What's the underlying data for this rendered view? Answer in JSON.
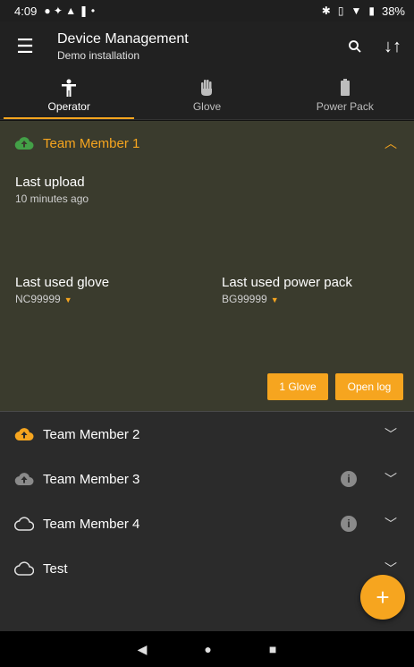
{
  "status_bar": {
    "time": "4:09",
    "battery": "38%"
  },
  "app_bar": {
    "title": "Device Management",
    "subtitle": "Demo installation"
  },
  "tabs": [
    {
      "label": "Operator",
      "icon": "person-icon",
      "active": true
    },
    {
      "label": "Glove",
      "icon": "hand-icon",
      "active": false
    },
    {
      "label": "Power Pack",
      "icon": "battery-icon",
      "active": false
    }
  ],
  "expanded_member": {
    "name": "Team Member 1",
    "cloud": "cloud-upload-green",
    "last_upload_label": "Last upload",
    "last_upload_value": "10 minutes ago",
    "last_glove_label": "Last used glove",
    "last_glove_value": "NC99999",
    "last_pack_label": "Last used power pack",
    "last_pack_value": "BG99999",
    "glove_button": "1 Glove",
    "open_log_button": "Open log"
  },
  "members": [
    {
      "name": "Team Member 2",
      "cloud": "cloud-upload-orange",
      "info": false
    },
    {
      "name": "Team Member 3",
      "cloud": "cloud-upload-grey",
      "info": true
    },
    {
      "name": "Team Member 4",
      "cloud": "cloud-outline",
      "info": true
    },
    {
      "name": "Test",
      "cloud": "cloud-outline",
      "info": false
    }
  ],
  "fab_label": "+",
  "colors": {
    "accent": "#f6a51f",
    "green": "#43a047",
    "expanded_bg": "#3a3b2d",
    "list_bg": "#2b2b2b"
  }
}
